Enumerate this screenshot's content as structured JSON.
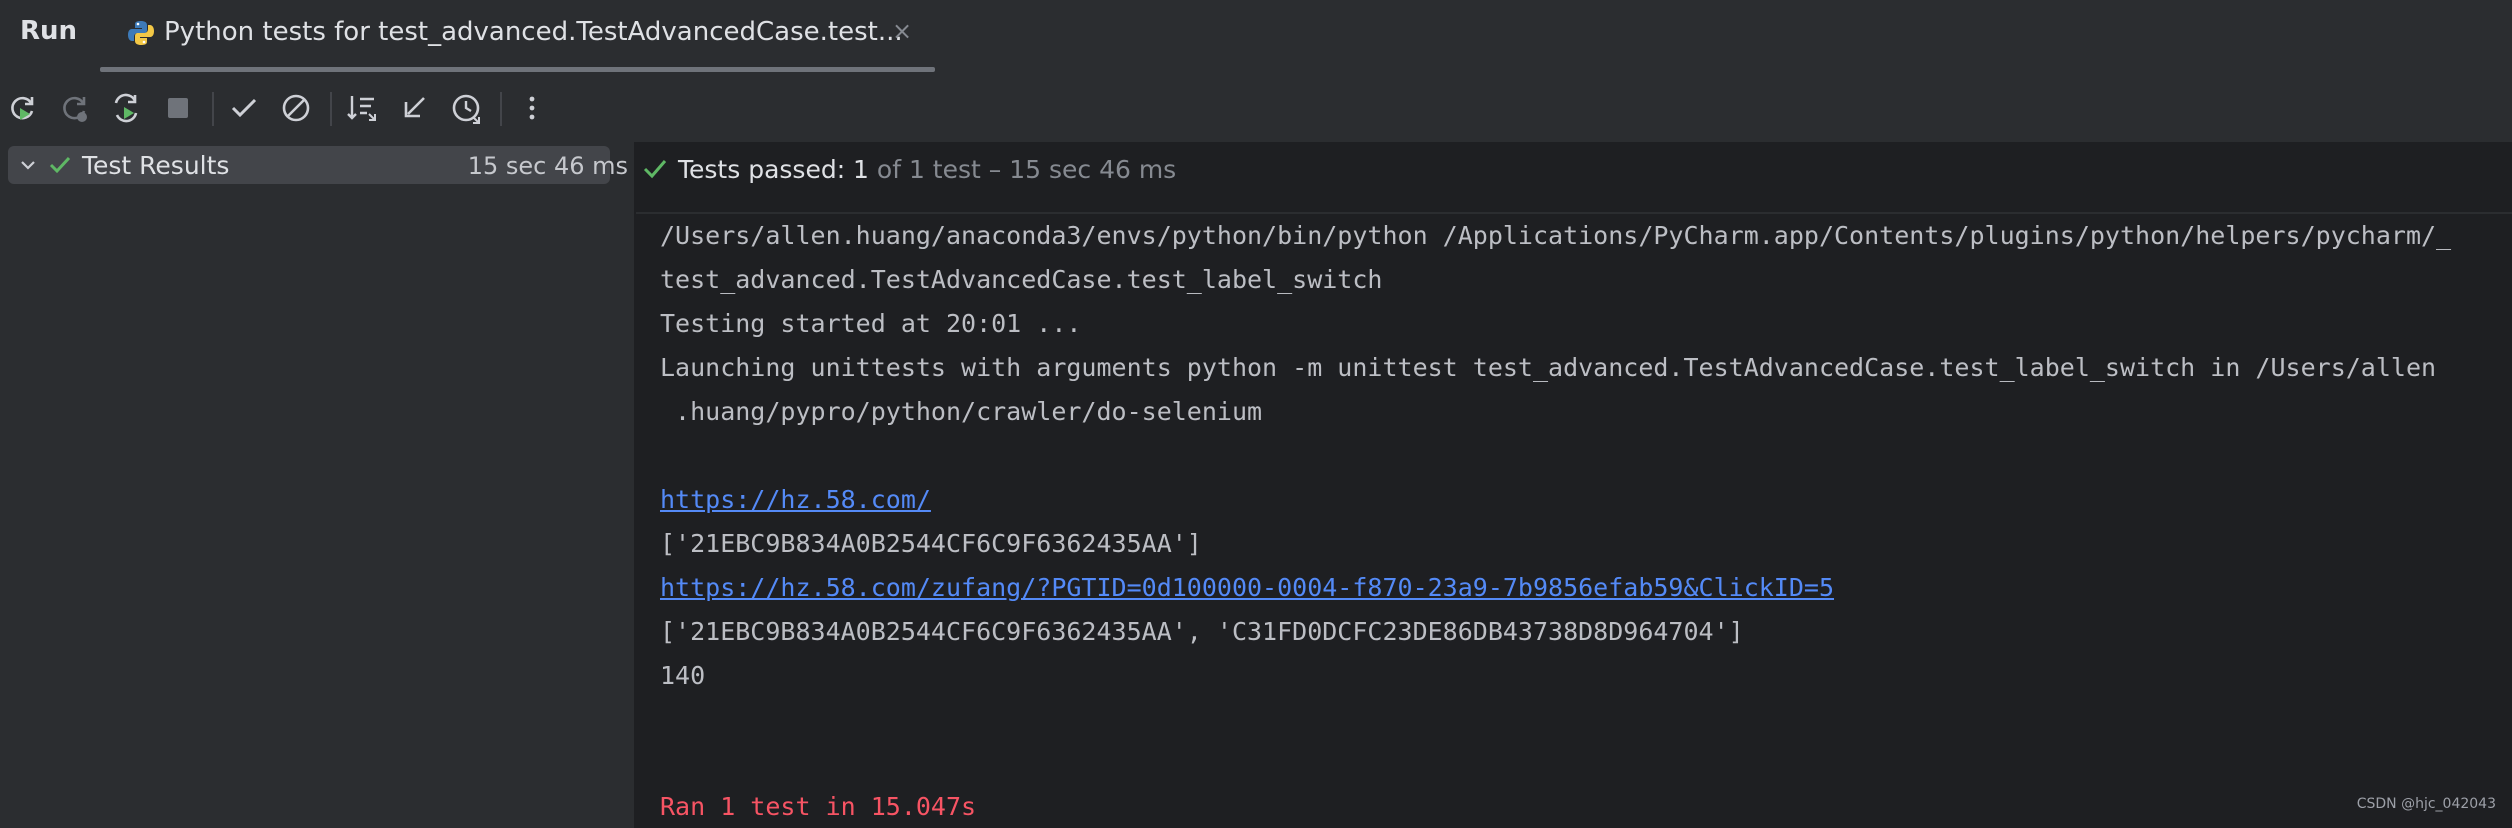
{
  "header": {
    "run_label": "Run",
    "tab_title": "Python tests for test_advanced.TestAdvancedCase.test...",
    "tab_close": "×"
  },
  "toolbar": {
    "buttons": [
      {
        "name": "rerun-icon"
      },
      {
        "name": "rerun-failed-icon"
      },
      {
        "name": "toggle-auto-test-icon"
      },
      {
        "name": "stop-icon"
      },
      {
        "name": "show-passed-icon"
      },
      {
        "name": "show-ignored-icon"
      },
      {
        "name": "sort-alphabetically-icon"
      },
      {
        "name": "collapse-all-icon"
      },
      {
        "name": "sort-by-duration-icon"
      },
      {
        "name": "more-options-icon"
      }
    ]
  },
  "results_tree": {
    "root_label": "Test Results",
    "root_time": "15 sec 46 ms"
  },
  "status": {
    "passed_label": "Tests passed: 1",
    "detail": " of 1 test – 15 sec 46 ms"
  },
  "console": {
    "lines": [
      "/Users/allen.huang/anaconda3/envs/python/bin/python /Applications/PyCharm.app/Contents/plugins/python/helpers/pycharm/_",
      "test_advanced.TestAdvancedCase.test_label_switch",
      "Testing started at 20:01 ...",
      "Launching unittests with arguments python -m unittest test_advanced.TestAdvancedCase.test_label_switch in /Users/allen",
      " .huang/pypro/python/crawler/do-selenium",
      "https://hz.58.com/",
      "['21EBC9B834A0B2544CF6C9F6362435AA']",
      "https://hz.58.com/zufang/?PGTID=0d100000-0004-f870-23a9-7b9856efab59&ClickID=5",
      "['21EBC9B834A0B2544CF6C9F6362435AA', 'C31FD0DCFC23DE86DB43738D8D964704']",
      "140",
      "Ran 1 test in 15.047s"
    ]
  },
  "watermark": "CSDN @hjc_042043",
  "colors": {
    "accent_link": "#548af7",
    "success": "#5fb865",
    "error": "#f75464"
  }
}
